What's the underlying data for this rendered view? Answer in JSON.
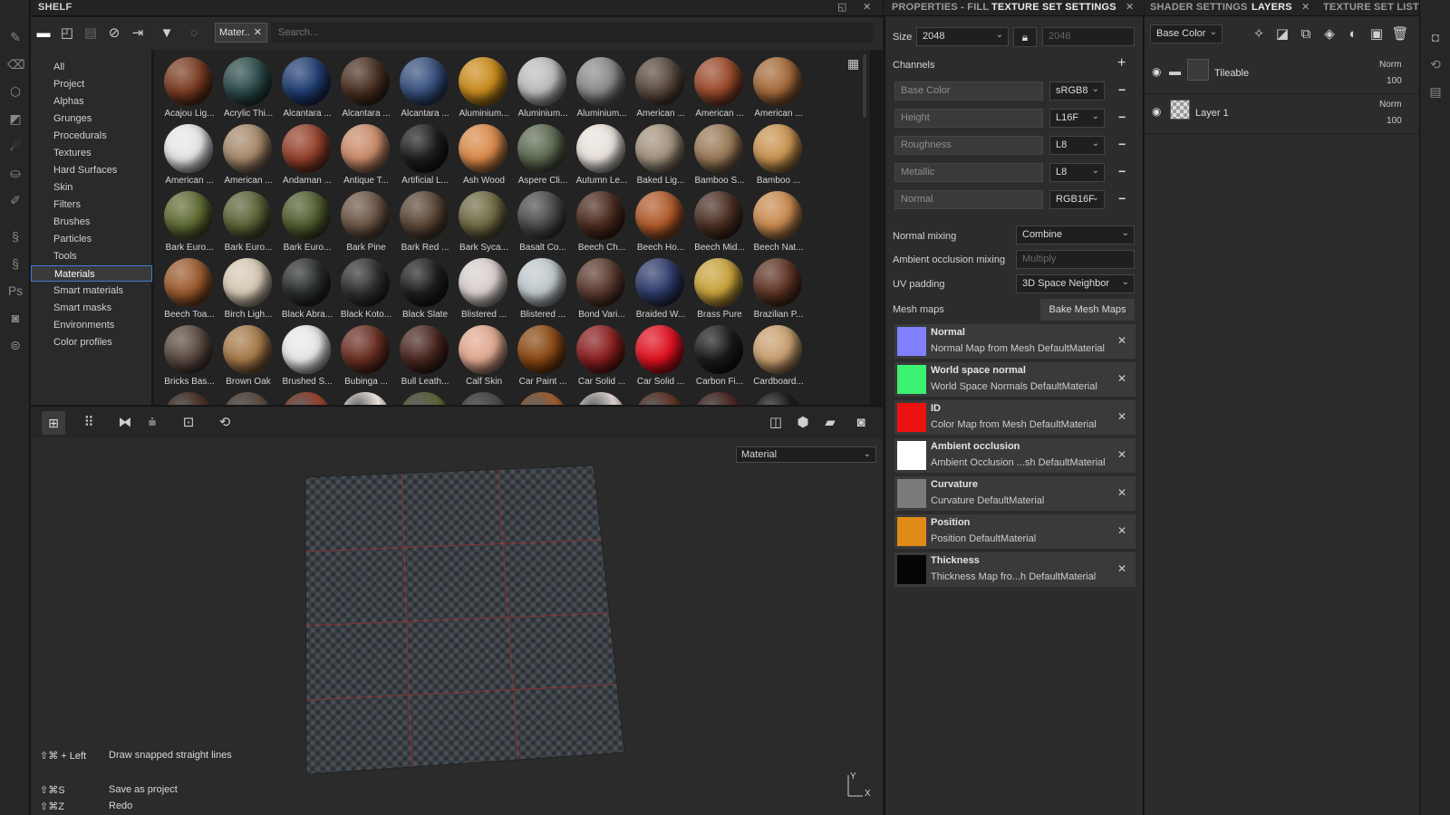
{
  "shelf": {
    "title": "SHELF",
    "filter_chip": "Mater..",
    "search_placeholder": "Search...",
    "categories": [
      "All",
      "Project",
      "Alphas",
      "Grunges",
      "Procedurals",
      "Textures",
      "Hard Surfaces",
      "Skin",
      "Filters",
      "Brushes",
      "Particles",
      "Tools",
      "Materials",
      "Smart materials",
      "Smart masks",
      "Environments",
      "Color profiles"
    ],
    "active_category": "Materials",
    "materials": [
      {
        "label": "Acajou Lig...",
        "color": "#7a3b22"
      },
      {
        "label": "Acrylic Thi...",
        "color": "#2b4a4a"
      },
      {
        "label": "Alcantara ...",
        "color": "#1f3d72"
      },
      {
        "label": "Alcantara ...",
        "color": "#4a3022"
      },
      {
        "label": "Alcantara ...",
        "color": "#36507d"
      },
      {
        "label": "Aluminium...",
        "color": "#c98a1c"
      },
      {
        "label": "Aluminium...",
        "color": "#bdbdbd"
      },
      {
        "label": "Aluminium...",
        "color": "#8a8a8a"
      },
      {
        "label": "American ...",
        "color": "#5a4a3e"
      },
      {
        "label": "American ...",
        "color": "#9b4a2c"
      },
      {
        "label": "American ...",
        "color": "#a56a3a"
      },
      {
        "label": "American ...",
        "color": "#e6e6e6"
      },
      {
        "label": "American ...",
        "color": "#a6886a"
      },
      {
        "label": "Andaman ...",
        "color": "#94402a"
      },
      {
        "label": "Antique T...",
        "color": "#c98a6a"
      },
      {
        "label": "Artificial L...",
        "color": "#1d1d1d"
      },
      {
        "label": "Ash Wood",
        "color": "#d98a4a"
      },
      {
        "label": "Aspere Cli...",
        "color": "#5d6a52"
      },
      {
        "label": "Autumn Le...",
        "color": "#e9e2dc"
      },
      {
        "label": "Baked Lig...",
        "color": "#a2927e"
      },
      {
        "label": "Bamboo S...",
        "color": "#9a7a58"
      },
      {
        "label": "Bamboo ...",
        "color": "#c99452"
      },
      {
        "label": "Bark Euro...",
        "color": "#5e6a32"
      },
      {
        "label": "Bark Euro...",
        "color": "#5a6236"
      },
      {
        "label": "Bark Euro...",
        "color": "#4e5c2e"
      },
      {
        "label": "Bark Pine",
        "color": "#6a5444"
      },
      {
        "label": "Bark Red ...",
        "color": "#5a4636"
      },
      {
        "label": "Bark Syca...",
        "color": "#6e6a44"
      },
      {
        "label": "Basalt Co...",
        "color": "#4a4a4a"
      },
      {
        "label": "Beech Ch...",
        "color": "#4a2a1e"
      },
      {
        "label": "Beech Ho...",
        "color": "#b05a2a"
      },
      {
        "label": "Beech Mid...",
        "color": "#4a2e22"
      },
      {
        "label": "Beech Nat...",
        "color": "#c98a50"
      },
      {
        "label": "Beech Toa...",
        "color": "#9a5a2e"
      },
      {
        "label": "Birch Ligh...",
        "color": "#d6c8b4"
      },
      {
        "label": "Black Abra...",
        "color": "#2a2e2c"
      },
      {
        "label": "Black Koto...",
        "color": "#2e3030"
      },
      {
        "label": "Black Slate",
        "color": "#1e1e1e"
      },
      {
        "label": "Blistered ...",
        "color": "#d8d0cc"
      },
      {
        "label": "Blistered ...",
        "color": "#c0c8cc"
      },
      {
        "label": "Bond Vari...",
        "color": "#5a3a2e"
      },
      {
        "label": "Braided W...",
        "color": "#2e3a6a"
      },
      {
        "label": "Brass Pure",
        "color": "#c8a23a"
      },
      {
        "label": "Brazilian P...",
        "color": "#5e3424"
      },
      {
        "label": "Bricks Bas...",
        "color": "#5a4a40"
      },
      {
        "label": "Brown Oak",
        "color": "#a67a4a"
      },
      {
        "label": "Brushed S...",
        "color": "#e8e8e8"
      },
      {
        "label": "Bubinga ...",
        "color": "#6a2e22"
      },
      {
        "label": "Bull Leath...",
        "color": "#4a2620"
      },
      {
        "label": "Calf Skin",
        "color": "#e0a890"
      },
      {
        "label": "Car Paint ...",
        "color": "#8a4812"
      },
      {
        "label": "Car Solid ...",
        "color": "#8a1e1e"
      },
      {
        "label": "Car Solid ...",
        "color": "#e01020"
      },
      {
        "label": "Carbon Fi...",
        "color": "#1a1a1a"
      },
      {
        "label": "Cardboard...",
        "color": "#c9a070"
      }
    ]
  },
  "viewport": {
    "mode_select": "Material",
    "shortcuts": [
      {
        "keys": "⇧⌘ + Left",
        "action": "Draw snapped straight lines"
      },
      {
        "keys": "⇧⌘S",
        "action": "Save as project"
      },
      {
        "keys": "⇧⌘Z",
        "action": "Redo"
      }
    ],
    "axis_y": "Y",
    "axis_x": "X"
  },
  "properties": {
    "tab_fill": "PROPERTIES - FILL",
    "tab_texture_set": "TEXTURE SET SETTINGS",
    "size_label": "Size",
    "size_value": "2048",
    "size_linked": "2048",
    "channels_label": "Channels",
    "channels": [
      {
        "name": "Base Color",
        "format": "sRGB8"
      },
      {
        "name": "Height",
        "format": "L16F"
      },
      {
        "name": "Roughness",
        "format": "L8"
      },
      {
        "name": "Metallic",
        "format": "L8"
      },
      {
        "name": "Normal",
        "format": "RGB16F"
      }
    ],
    "normal_mixing_label": "Normal mixing",
    "normal_mixing_value": "Combine",
    "ao_mixing_label": "Ambient occlusion mixing",
    "ao_mixing_value": "Multiply",
    "uv_padding_label": "UV padding",
    "uv_padding_value": "3D Space Neighbor",
    "mesh_maps_label": "Mesh maps",
    "bake_button": "Bake Mesh Maps",
    "mesh_maps": [
      {
        "name": "Normal",
        "sub": "Normal Map from Mesh DefaultMaterial",
        "color": "#7f7fff"
      },
      {
        "name": "World space normal",
        "sub": "World Space Normals DefaultMaterial",
        "color": "#3cf070"
      },
      {
        "name": "ID",
        "sub": "Color Map from Mesh DefaultMaterial",
        "color": "#ee1111"
      },
      {
        "name": "Ambient occlusion",
        "sub": "Ambient Occlusion ...sh DefaultMaterial",
        "color": "#ffffff"
      },
      {
        "name": "Curvature",
        "sub": "Curvature DefaultMaterial",
        "color": "#7a7a7a"
      },
      {
        "name": "Position",
        "sub": "Position DefaultMaterial",
        "color": "#e08a18"
      },
      {
        "name": "Thickness",
        "sub": "Thickness Map fro...h DefaultMaterial",
        "color": "#050505"
      }
    ]
  },
  "layers": {
    "tab_shader": "SHADER SETTINGS",
    "tab_layers": "LAYERS",
    "tab_texture_set_list": "TEXTURE SET LIST",
    "channel_select": "Base Color",
    "items": [
      {
        "name": "Tileable",
        "blend": "Norm",
        "opacity": "100"
      },
      {
        "name": "Layer 1",
        "blend": "Norm",
        "opacity": "100"
      }
    ]
  }
}
